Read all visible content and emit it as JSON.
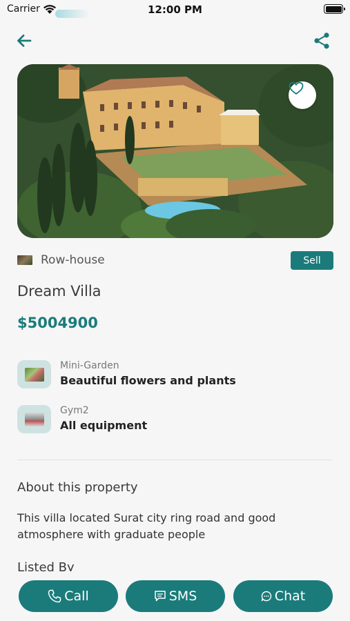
{
  "status_bar": {
    "carrier": "Carrier",
    "time": "12:00 PM"
  },
  "nav": {
    "back_icon": "arrow-left-icon",
    "share_icon": "share-icon"
  },
  "property": {
    "type": "Row-house",
    "listing_badge": "Sell",
    "title": "Dream Villa",
    "price": "$5004900"
  },
  "features": [
    {
      "name": "Mini-Garden",
      "description": "Beautiful flowers and plants"
    },
    {
      "name": "Gym2",
      "description": "All equipment"
    }
  ],
  "about": {
    "heading": "About this property",
    "text": "This villa located Surat city ring road and good atmosphere with graduate people"
  },
  "listed_by": {
    "heading": "Listed By"
  },
  "actions": {
    "call": "Call",
    "sms": "SMS",
    "chat": "Chat"
  },
  "colors": {
    "accent": "#1b7b7b",
    "background": "#f6f6f6"
  }
}
